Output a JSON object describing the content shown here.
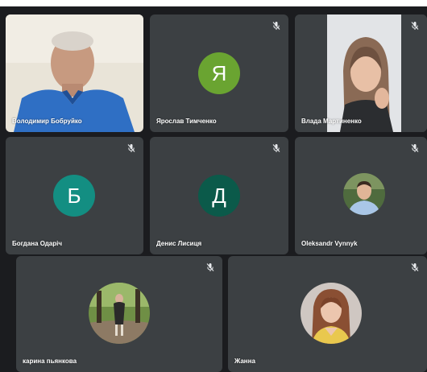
{
  "participants": [
    {
      "name": "Володимир Бобруйко",
      "type": "video"
    },
    {
      "name": "Ярослав Тимченко",
      "initial": "Я",
      "color": "#6aa431",
      "muted": true
    },
    {
      "name": "Влада Мартиненко",
      "type": "video",
      "muted": true
    },
    {
      "name": "Богдана Одаріч",
      "initial": "Б",
      "color": "#138e82",
      "muted": true
    },
    {
      "name": "Денис Лисиця",
      "initial": "Д",
      "color": "#0b5a4a",
      "muted": true
    },
    {
      "name": "Oleksandr Vynnyk",
      "type": "photo",
      "muted": true
    },
    {
      "name": "карина пьянкова",
      "type": "photo",
      "muted": true
    },
    {
      "name": "Жанна",
      "type": "photo",
      "muted": true
    }
  ],
  "icons": {
    "muted": "mic-off-icon"
  }
}
